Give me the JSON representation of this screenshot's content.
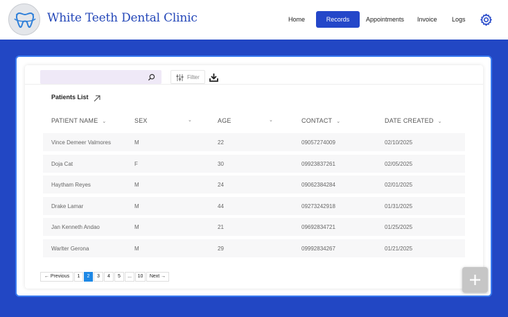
{
  "header": {
    "brand": "White Teeth Dental Clinic",
    "nav": [
      {
        "label": "Home"
      },
      {
        "label": "Records",
        "active": true
      },
      {
        "label": "Appointments"
      },
      {
        "label": "Invoice"
      },
      {
        "label": "Logs"
      }
    ]
  },
  "toolbar": {
    "search_value": "",
    "filter_label": "Filter"
  },
  "list": {
    "title": "Patients List",
    "columns": [
      "PATIENT NAME",
      "SEX",
      "AGE",
      "CONTACT",
      "DATE CREATED"
    ],
    "rows": [
      [
        "Vince Demeer Valmores",
        "M",
        "22",
        "09057274009",
        "02/10/2025"
      ],
      [
        "Doja Cat",
        "F",
        "30",
        "09923837261",
        "02/05/2025"
      ],
      [
        "Haytham Reyes",
        "M",
        "24",
        "09062384284",
        "02/01/2025"
      ],
      [
        "Drake Lamar",
        "M",
        "44",
        "09273242918",
        "01/31/2025"
      ],
      [
        "Jan Kenneth Andao",
        "M",
        "21",
        "09692834721",
        "01/25/2025"
      ],
      [
        "Warlter Gerona",
        "M",
        "29",
        "09992834267",
        "01/21/2025"
      ]
    ]
  },
  "pagination": {
    "prev": "← Previous",
    "pages": [
      "1",
      "2",
      "3",
      "4",
      "5",
      "...",
      "10"
    ],
    "current": "2",
    "next": "Next →"
  },
  "colors": {
    "accent": "#2447c9",
    "background": "#2247c4",
    "active_page": "#1e88e5"
  },
  "icons": [
    "tooth-logo-icon",
    "gear-icon",
    "search-icon",
    "filter-sliders-icon",
    "download-icon",
    "arrow-up-right-icon",
    "chevron-down-icon",
    "plus-icon"
  ]
}
